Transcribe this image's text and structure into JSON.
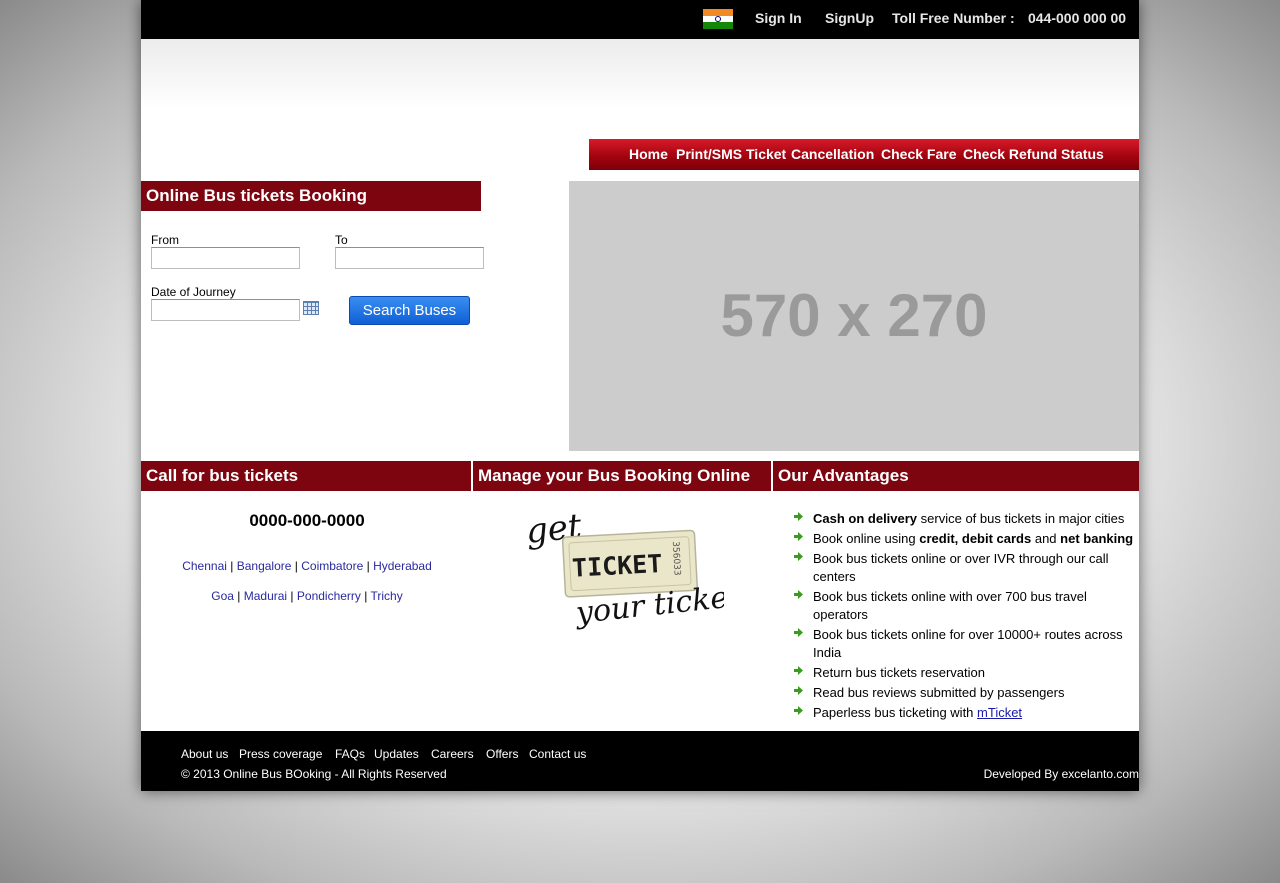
{
  "topbar": {
    "signin": "Sign In",
    "signup": "SignUp",
    "toll_free_label": "Toll Free Number :",
    "toll_free_number": "044-000 000 00"
  },
  "nav": [
    "Home",
    "Print/SMS Ticket",
    "Cancellation",
    "Check Fare",
    "Check Refund Status"
  ],
  "booking": {
    "title": "Online Bus tickets Booking",
    "from_label": "From",
    "to_label": "To",
    "date_label": "Date of Journey",
    "from_value": "",
    "to_value": "",
    "date_value": "",
    "search_label": "Search Buses"
  },
  "banner": {
    "text": "570 x 270"
  },
  "call": {
    "title": "Call for bus tickets",
    "phone": "0000-000-0000",
    "cities_row1": [
      "Chennai",
      "Bangalore",
      "Coimbatore",
      "Hyderabad"
    ],
    "cities_row2": [
      "Goa",
      "Madurai",
      "Pondicherry",
      "Trichy"
    ]
  },
  "manage": {
    "title": "Manage your Bus Booking Online",
    "logo_get": "get",
    "logo_ticket": "TICKET",
    "logo_your": "your ticket",
    "logo_number": "356033"
  },
  "advantages": {
    "title": "Our Advantages",
    "items": [
      {
        "bold": "Cash on delivery",
        "text": " service of bus tickets in major cities"
      },
      {
        "pre": "Book online using ",
        "bold": "credit, debit cards",
        "mid": " and ",
        "bold2": "net banking"
      },
      {
        "text": "Book bus tickets online or over IVR through our call centers"
      },
      {
        "text": "Book bus tickets online with over 700 bus travel operators"
      },
      {
        "text": "Book bus tickets online for over 10000+ routes across India"
      },
      {
        "text": "Return bus tickets reservation"
      },
      {
        "text": "Read bus reviews submitted by passengers"
      },
      {
        "text": "Paperless bus ticketing with ",
        "link": "mTicket"
      }
    ]
  },
  "footer": {
    "links": [
      "About us",
      "Press coverage",
      "FAQs",
      "Updates",
      "Careers",
      "Offers",
      "Contact us"
    ],
    "copyright": "© 2013 Online Bus BOoking - All Rights Reserved",
    "developer": "Developed By excelanto.com"
  },
  "colors": {
    "section_bar": "#7d0510",
    "nav_red": "#c0101e",
    "button_blue": "#1f6fe0",
    "link_blue": "#2a2aa0"
  },
  "icons": [
    "india-flag-icon",
    "calendar-icon",
    "green-arrow-icon"
  ]
}
